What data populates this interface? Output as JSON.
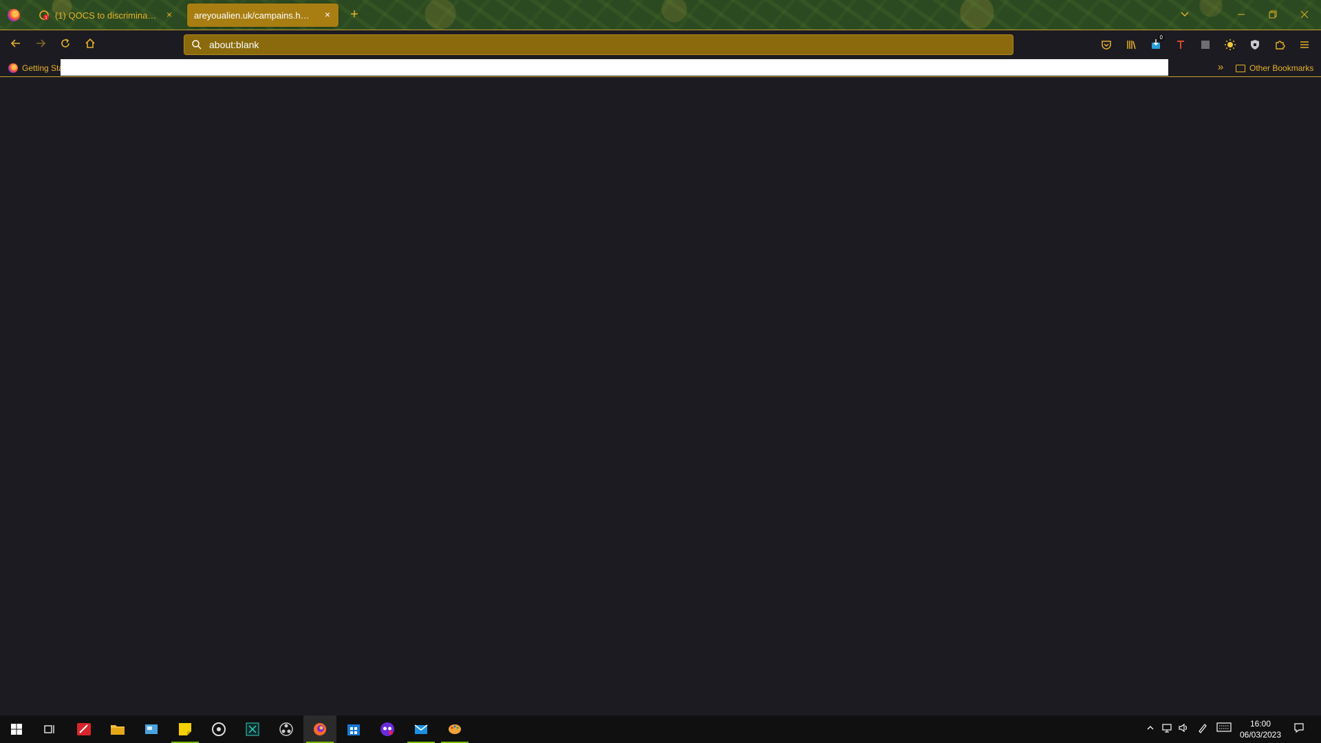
{
  "browser": {
    "tabs": [
      {
        "label": "(1) QOCS to discrimination! - ...",
        "active": false,
        "close_glyph": "×"
      },
      {
        "label": "areyoualien.uk/campains.html",
        "active": true,
        "close_glyph": "×"
      }
    ],
    "new_tab_glyph": "+",
    "url": "about:blank",
    "bookmarks": {
      "getting_started": "Getting Sta",
      "overflow_glyph": "»",
      "other": "Other Bookmarks"
    },
    "downloads_badge": "0"
  },
  "taskbar": {
    "clock_time": "16:00",
    "clock_date": "06/03/2023"
  },
  "colors": {
    "accent": "#e8b228",
    "urlbar_bg": "#8a6a0c",
    "active_tab_bg": "#a87e12",
    "content_bg": "#1c1b22"
  }
}
